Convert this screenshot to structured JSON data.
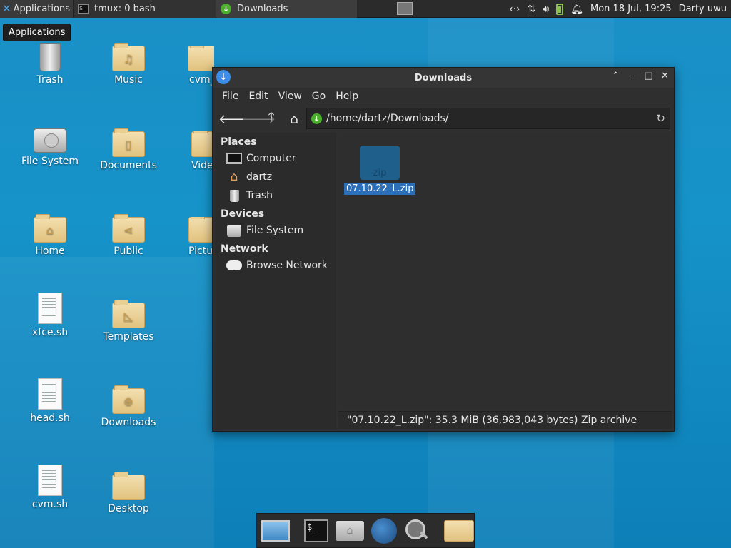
{
  "top_panel": {
    "applications_label": "Applications",
    "tasks": [
      {
        "label": "tmux: 0 bash"
      },
      {
        "label": "Downloads"
      }
    ],
    "clock": "Mon 18 Jul, 19:25",
    "user": "Darty uwu"
  },
  "tooltip": "Applications",
  "desktop_icons": [
    {
      "label": "Trash",
      "icon": "trash-icon"
    },
    {
      "label": "Music",
      "icon": "music-folder-icon"
    },
    {
      "label": "cvm_",
      "icon": "folder-icon"
    },
    {
      "label": "File System",
      "icon": "harddisk-icon"
    },
    {
      "label": "Documents",
      "icon": "documents-folder-icon"
    },
    {
      "label": "Vide",
      "icon": "videos-folder-icon"
    },
    {
      "label": "Home",
      "icon": "home-folder-icon"
    },
    {
      "label": "Public",
      "icon": "public-folder-icon"
    },
    {
      "label": "Pictu",
      "icon": "pictures-folder-icon"
    },
    {
      "label": "xfce.sh",
      "icon": "script-file-icon"
    },
    {
      "label": "Templates",
      "icon": "templates-folder-icon"
    },
    {
      "label": "head.sh",
      "icon": "script-file-icon"
    },
    {
      "label": "Downloads",
      "icon": "downloads-folder-icon"
    },
    {
      "label": "cvm.sh",
      "icon": "script-file-icon"
    },
    {
      "label": "Desktop",
      "icon": "folder-icon"
    }
  ],
  "window": {
    "title": "Downloads",
    "menu": [
      "File",
      "Edit",
      "View",
      "Go",
      "Help"
    ],
    "location": "/home/dartz/Downloads/",
    "sidebar": {
      "places_header": "Places",
      "places": [
        "Computer",
        "dartz",
        "Trash"
      ],
      "devices_header": "Devices",
      "devices": [
        "File System"
      ],
      "network_header": "Network",
      "network": [
        "Browse Network"
      ]
    },
    "file": {
      "name": "07.10.22_L.zip",
      "icon_text": "zip"
    },
    "status": "\"07.10.22_L.zip\": 35.3 MiB (36,983,043 bytes) Zip archive"
  },
  "colors": {
    "desktop_bg": "#1693c9",
    "panel_bg": "#2b2b2b",
    "selection": "#2a6fb7",
    "window_bg": "#2f2f2f"
  }
}
